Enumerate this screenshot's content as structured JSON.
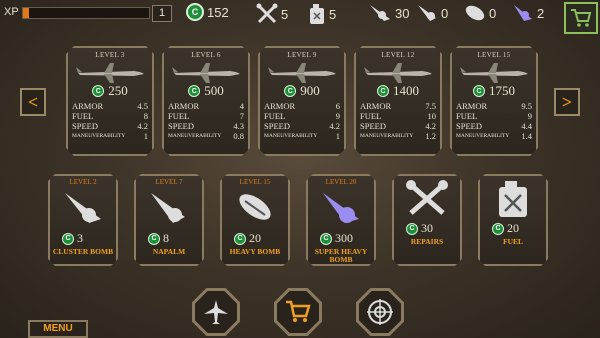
{
  "top": {
    "xp_label": "XP",
    "xp_level": "1",
    "xp_progress": 0.05,
    "coins": "152",
    "repairs": "5",
    "fuel": "5",
    "cluster": "30",
    "napalm": "0",
    "heavy": "0",
    "super_heavy": "2"
  },
  "planes": [
    {
      "level": "LEVEL 3",
      "price": "250",
      "armor": "4.5",
      "fuel": "8",
      "speed": "4.2",
      "maneuver": "1"
    },
    {
      "level": "LEVEL 6",
      "price": "500",
      "armor": "4",
      "fuel": "7",
      "speed": "4.3",
      "maneuver": "0.8"
    },
    {
      "level": "LEVEL 9",
      "price": "900",
      "armor": "6",
      "fuel": "9",
      "speed": "4.2",
      "maneuver": "1"
    },
    {
      "level": "LEVEL 12",
      "price": "1400",
      "armor": "7.5",
      "fuel": "10",
      "speed": "4.2",
      "maneuver": "1.2"
    },
    {
      "level": "LEVEL 15",
      "price": "1750",
      "armor": "9.5",
      "fuel": "9",
      "speed": "4.4",
      "maneuver": "1.4"
    }
  ],
  "stat_labels": {
    "armor": "ARMOR",
    "fuel": "FUEL",
    "speed": "SPEED",
    "maneuver": "MANEUVERABILITY"
  },
  "items": [
    {
      "level": "LEVEL 2",
      "price": "3",
      "name": "CLUSTER BOMB"
    },
    {
      "level": "LEVEL 7",
      "price": "8",
      "name": "NAPALM"
    },
    {
      "level": "LEVEL 15",
      "price": "20",
      "name": "HEAVY BOMB"
    },
    {
      "level": "LEVEL 20",
      "price": "300",
      "name": "SUPER HEAVY BOMB"
    },
    {
      "level": "",
      "price": "30",
      "name": "REPAIRS"
    },
    {
      "level": "",
      "price": "20",
      "name": "FUEL"
    }
  ],
  "coin_symbol": "C",
  "nav": {
    "prev": "<",
    "next": ">",
    "menu": "MENU"
  }
}
